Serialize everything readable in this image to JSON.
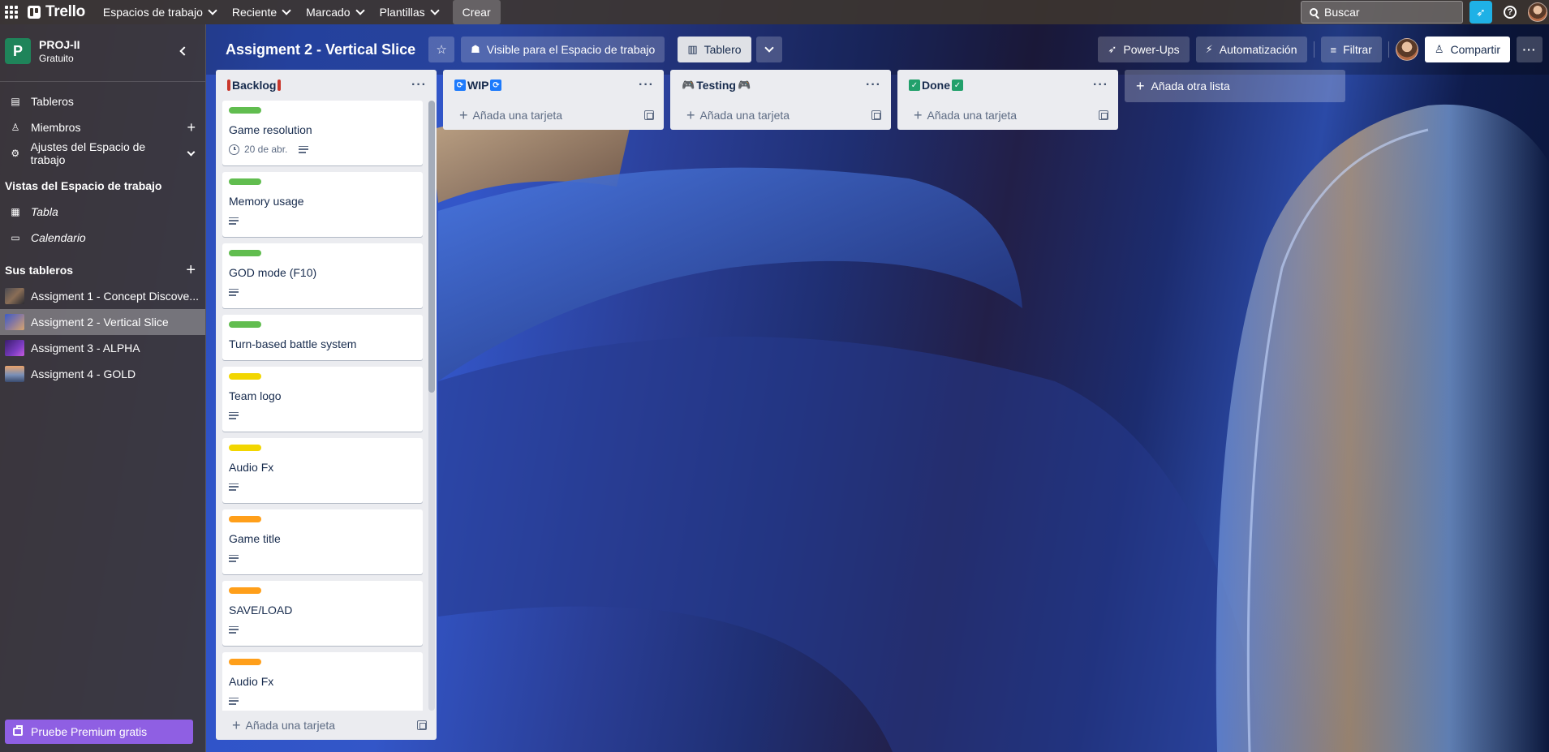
{
  "topbar": {
    "logo": "Trello",
    "nav": [
      "Espacios de trabajo",
      "Reciente",
      "Marcado",
      "Plantillas"
    ],
    "create": "Crear",
    "search_placeholder": "Buscar"
  },
  "sidebar": {
    "workspace_initial": "P",
    "workspace_name": "PROJ-II",
    "workspace_plan": "Gratuito",
    "items": [
      {
        "label": "Tableros"
      },
      {
        "label": "Miembros"
      },
      {
        "label": "Ajustes del Espacio de trabajo"
      }
    ],
    "views_heading": "Vistas del Espacio de trabajo",
    "views": [
      {
        "label": "Tabla"
      },
      {
        "label": "Calendario"
      }
    ],
    "boards_heading": "Sus tableros",
    "boards": [
      {
        "label": "Assigment 1 - Concept Discove..."
      },
      {
        "label": "Assigment 2 - Vertical Slice"
      },
      {
        "label": "Assigment 3 - ALPHA"
      },
      {
        "label": "Assigment 4 - GOLD"
      }
    ],
    "premium": "Pruebe Premium gratis"
  },
  "board": {
    "title": "Assigment 2 - Vertical Slice",
    "visibility": "Visible para el Espacio de trabajo",
    "view": "Tablero",
    "powerups": "Power-Ups",
    "automation": "Automatización",
    "filter": "Filtrar",
    "share": "Compartir"
  },
  "lists": [
    {
      "title": "Backlog",
      "add_card": "Añada una tarjeta",
      "cards": [
        {
          "title": "Game resolution",
          "label_color": "#61bd4f",
          "due": "20 de abr.",
          "has_desc": true
        },
        {
          "title": "Memory usage",
          "label_color": "#61bd4f",
          "has_desc": true
        },
        {
          "title": "GOD mode (F10)",
          "label_color": "#61bd4f",
          "has_desc": true
        },
        {
          "title": "Turn-based battle system",
          "label_color": "#61bd4f",
          "has_desc": false
        },
        {
          "title": "Team logo",
          "label_color": "#f2d600",
          "has_desc": true
        },
        {
          "title": "Audio Fx",
          "label_color": "#f2d600",
          "has_desc": true
        },
        {
          "title": "Game title",
          "label_color": "#ff9f1a",
          "has_desc": true
        },
        {
          "title": "SAVE/LOAD",
          "label_color": "#ff9f1a",
          "has_desc": true
        },
        {
          "title": "Audio Fx",
          "label_color": "#ff9f1a",
          "has_desc": true
        }
      ]
    },
    {
      "title": "WIP",
      "add_card": "Añada una tarjeta",
      "cards": []
    },
    {
      "title": "Testing",
      "add_card": "Añada una tarjeta",
      "cards": []
    },
    {
      "title": "Done",
      "add_card": "Añada una tarjeta",
      "cards": []
    }
  ],
  "add_list": "Añada otra lista",
  "colors": {
    "accent_green": "#1f845a",
    "premium_purple": "#8f5fe3",
    "notif_blue": "#1fb1e6"
  }
}
